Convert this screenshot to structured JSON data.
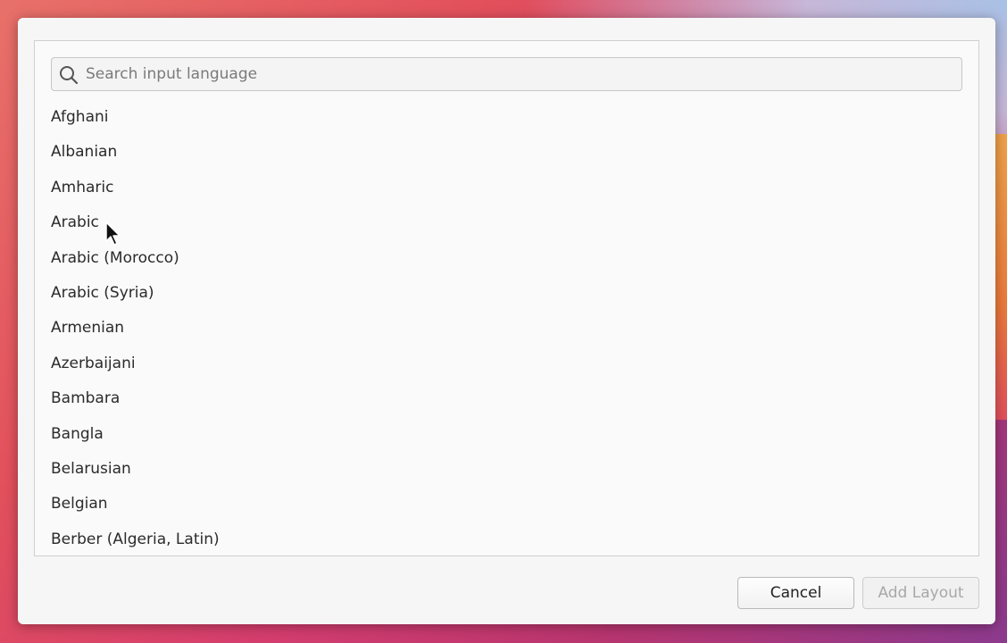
{
  "dialog": {
    "search": {
      "placeholder": "Search input language",
      "value": ""
    },
    "languages": [
      "Afghani",
      "Albanian",
      "Amharic",
      "Arabic",
      "Arabic (Morocco)",
      "Arabic (Syria)",
      "Armenian",
      "Azerbaijani",
      "Bambara",
      "Bangla",
      "Belarusian",
      "Belgian",
      "Berber (Algeria, Latin)"
    ],
    "buttons": {
      "cancel_label": "Cancel",
      "add_label": "Add Layout"
    }
  },
  "colors": {
    "dialog_bg": "#f6f6f6",
    "list_bg": "#fafafa",
    "disabled_text": "#a8a8a8"
  },
  "icons": [
    "search-icon",
    "mouse-cursor-icon"
  ]
}
